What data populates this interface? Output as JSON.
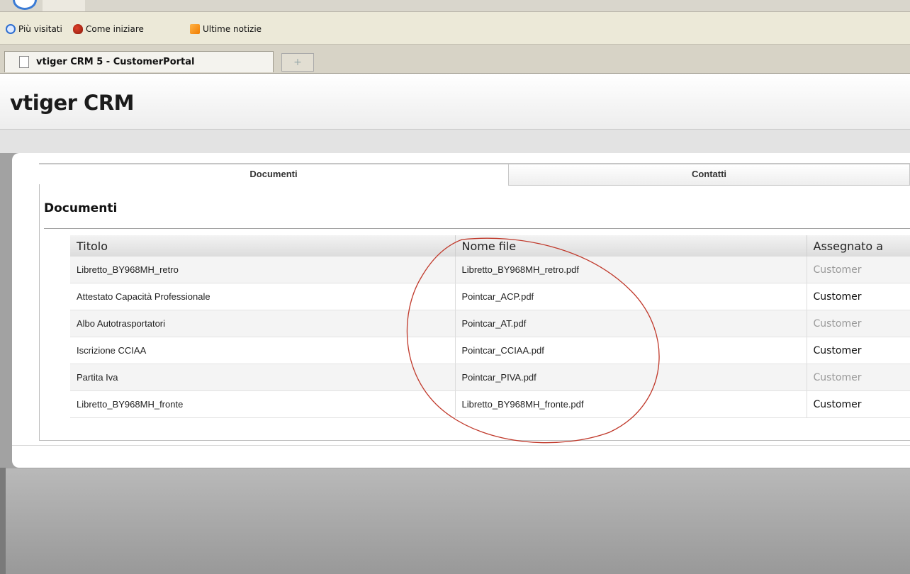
{
  "browser": {
    "bookmarks": [
      {
        "label": "Più visitati",
        "icon": "search-icon"
      },
      {
        "label": "Come iniziare",
        "icon": "firefox-icon"
      },
      {
        "label": "Ultime notizie",
        "icon": "rss-feed-icon"
      }
    ],
    "tab_title": "vtiger CRM 5 - CustomerPortal",
    "new_tab_symbol": "+"
  },
  "header": {
    "logo": "vtiger CRM"
  },
  "tabs": [
    {
      "label": "Documenti",
      "active": true
    },
    {
      "label": "Contatti",
      "active": false
    }
  ],
  "section_title": "Documenti",
  "table": {
    "columns": [
      "Titolo",
      "Nome file",
      "Assegnato a"
    ],
    "rows": [
      {
        "titolo": "Libretto_BY968MH_retro",
        "nome_file": "Libretto_BY968MH_retro.pdf",
        "assegnato": "Customer"
      },
      {
        "titolo": "Attestato Capacità Professionale",
        "nome_file": "Pointcar_ACP.pdf",
        "assegnato": "Customer"
      },
      {
        "titolo": "Albo Autotrasportatori",
        "nome_file": "Pointcar_AT.pdf",
        "assegnato": "Customer"
      },
      {
        "titolo": "Iscrizione CCIAA",
        "nome_file": "Pointcar_CCIAA.pdf",
        "assegnato": "Customer"
      },
      {
        "titolo": "Partita Iva",
        "nome_file": "Pointcar_PIVA.pdf",
        "assegnato": "Customer"
      },
      {
        "titolo": "Libretto_BY968MH_fronte",
        "nome_file": "Libretto_BY968MH_fronte.pdf",
        "assegnato": "Customer"
      }
    ]
  },
  "colors": {
    "annotation": "#c0392b",
    "page_background": "#a2a2a2"
  }
}
